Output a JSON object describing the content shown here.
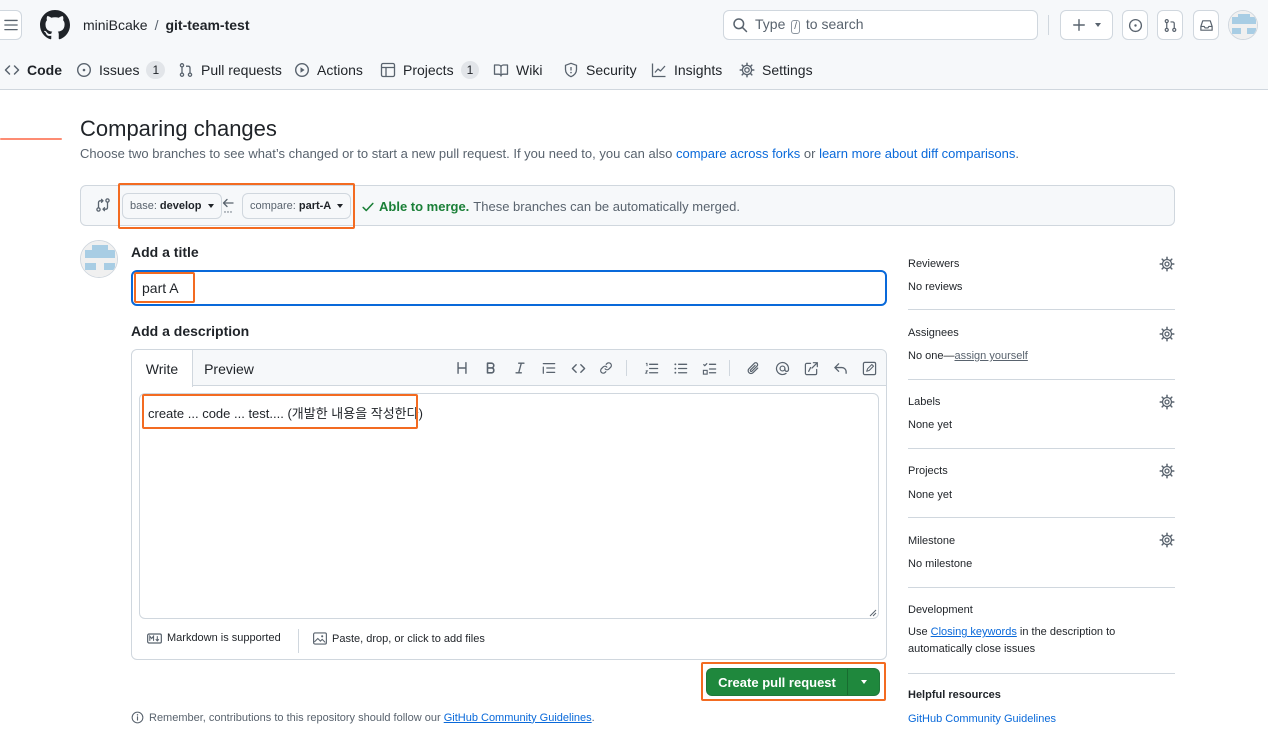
{
  "header": {
    "owner": "miniBcake",
    "separator": "/",
    "repo": "git-team-test",
    "search": {
      "prefix": "Type",
      "key": "/",
      "suffix": "to search"
    }
  },
  "repo_nav": {
    "tabs": [
      {
        "label": "Code",
        "icon": "code-icon",
        "selected": true
      },
      {
        "label": "Issues",
        "icon": "issue-opened-icon",
        "count": "1"
      },
      {
        "label": "Pull requests",
        "icon": "git-pull-request-icon"
      },
      {
        "label": "Actions",
        "icon": "play-icon"
      },
      {
        "label": "Projects",
        "icon": "table-icon",
        "count": "1"
      },
      {
        "label": "Wiki",
        "icon": "book-icon"
      },
      {
        "label": "Security",
        "icon": "shield-icon"
      },
      {
        "label": "Insights",
        "icon": "graph-icon"
      },
      {
        "label": "Settings",
        "icon": "gear-icon"
      }
    ]
  },
  "compare": {
    "title": "Comparing changes",
    "subtitle_text": "Choose two branches to see what’s changed or to start a new pull request. If you need to, you can also",
    "link_forks": "compare across forks",
    "or_text": "or",
    "link_learn": "learn more about diff comparisons",
    "period": ".",
    "base_prefix": "base:",
    "base_branch": "develop",
    "compare_prefix": "compare:",
    "compare_branch": "part-A",
    "merge_ok": "Able to merge.",
    "merge_msg": "These branches can be automatically merged."
  },
  "form": {
    "title_label": "Add a title",
    "title_value": "part A",
    "desc_label": "Add a description",
    "tab_write": "Write",
    "tab_preview": "Preview",
    "desc_value": "create ... code ... test.... (개발한 내용을 작성한다)",
    "markdown_note": "Markdown is supported",
    "attach_note": "Paste, drop, or click to add files",
    "submit_label": "Create pull request",
    "footer_note": "Remember, contributions to this repository should follow our",
    "footer_link": "GitHub Community Guidelines",
    "footer_end": "."
  },
  "sidebar": {
    "reviewers": {
      "label": "Reviewers",
      "value": "No reviews"
    },
    "assignees": {
      "label": "Assignees",
      "value_prefix": "No one—",
      "link": "assign yourself"
    },
    "labels": {
      "label": "Labels",
      "value": "None yet"
    },
    "projects": {
      "label": "Projects",
      "value": "None yet"
    },
    "milestone": {
      "label": "Milestone",
      "value": "No milestone"
    },
    "development": {
      "label": "Development",
      "pre": "Use",
      "link": "Closing keywords",
      "post": "in the description to",
      "line2": "automatically close issues"
    },
    "helpful": {
      "label": "Helpful resources",
      "link": "GitHub Community Guidelines"
    }
  },
  "colors": {
    "accent": "#0969da",
    "success": "#1f883d",
    "highlight": "#f36b21",
    "tab_underline": "#fd8c73"
  }
}
